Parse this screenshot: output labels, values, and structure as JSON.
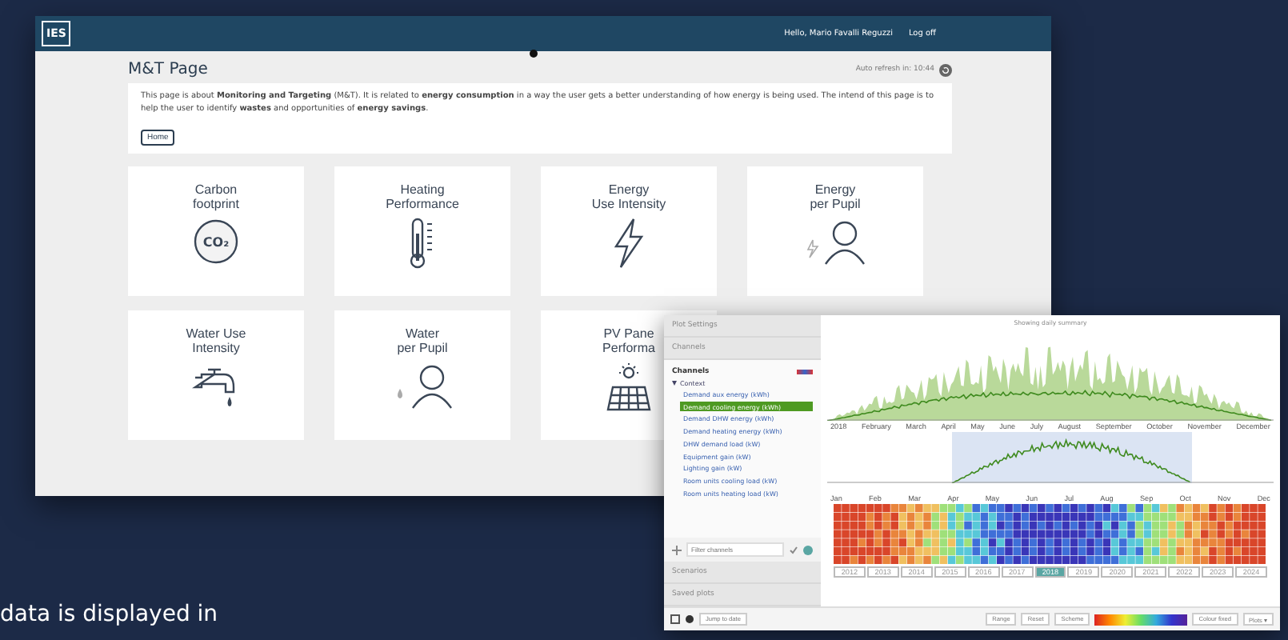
{
  "caption": "data is displayed in",
  "main_window": {
    "logo": "IES",
    "greeting": "Hello, Mario Favalli Reguzzi",
    "logoff": "Log off",
    "title": "M&T Page",
    "auto_refresh": "Auto refresh in: 10:44",
    "description": "This page is about **Monitoring and Targeting** (M&T). It is related to **energy consumption** in a way the user gets a better understanding of how energy is being used. The intend of this page is to help the user to identify **wastes** and opportunities of **energy savings**.",
    "home_button": "Home",
    "cards": [
      {
        "title": "Carbon\nfootprint",
        "kind": "co2",
        "icon_text": "CO₂"
      },
      {
        "title": "Heating\nPerformance",
        "kind": "thermometer"
      },
      {
        "title": "Energy\nUse Intensity",
        "kind": "bolt"
      },
      {
        "title": "Energy\nper Pupil",
        "kind": "person-bolt"
      },
      {
        "title": "Water Use\nIntensity",
        "kind": "tap"
      },
      {
        "title": "Water\nper Pupil",
        "kind": "person-drop"
      },
      {
        "title": "PV Pane\nPerforma",
        "kind": "solar"
      }
    ]
  },
  "plot_window": {
    "sections": [
      "Plot Settings",
      "Channels"
    ],
    "channels_title": "Channels",
    "tree": [
      {
        "label": "Context",
        "expanded": true,
        "children": [
          {
            "label": "Demand aux energy (kWh)",
            "selected": false
          },
          {
            "label": "Demand cooling energy (kWh)",
            "selected": true
          },
          {
            "label": "Demand DHW energy (kWh)",
            "selected": false
          },
          {
            "label": "Demand heating energy (kWh)",
            "selected": false
          },
          {
            "label": "DHW demand load (kW)",
            "selected": false
          },
          {
            "label": "Equipment gain (kW)",
            "selected": false
          },
          {
            "label": "Lighting gain (kW)",
            "selected": false
          },
          {
            "label": "Room units cooling load (kW)",
            "selected": false
          },
          {
            "label": "Room units heating load (kW)",
            "selected": false
          }
        ]
      }
    ],
    "filter_placeholder": "Filter channels",
    "bottom_sections": [
      "Scenarios",
      "Saved plots"
    ],
    "chart_title": "Showing daily summary",
    "months": [
      "2018",
      "February",
      "March",
      "April",
      "May",
      "June",
      "July",
      "August",
      "September",
      "October",
      "November",
      "December"
    ],
    "heatmap_months": [
      "Jan",
      "Feb",
      "Mar",
      "Apr",
      "May",
      "Jun",
      "Jul",
      "Aug",
      "Sep",
      "Oct",
      "Nov",
      "Dec"
    ],
    "years": [
      {
        "label": "2012",
        "selected": false
      },
      {
        "label": "2013",
        "selected": false
      },
      {
        "label": "2014",
        "selected": false
      },
      {
        "label": "2015",
        "selected": false
      },
      {
        "label": "2016",
        "selected": false
      },
      {
        "label": "2017",
        "selected": false
      },
      {
        "label": "2018",
        "selected": true
      },
      {
        "label": "2019",
        "selected": false
      },
      {
        "label": "2020",
        "selected": false
      },
      {
        "label": "2021",
        "selected": false
      },
      {
        "label": "2022",
        "selected": false
      },
      {
        "label": "2023",
        "selected": false
      },
      {
        "label": "2024",
        "selected": false
      }
    ],
    "toolbar": {
      "jump": "Jump to date",
      "range": "Range",
      "reset": "Reset",
      "scheme": "Scheme",
      "fixed": "Colour fixed",
      "plots": "Plots ▾"
    }
  }
}
